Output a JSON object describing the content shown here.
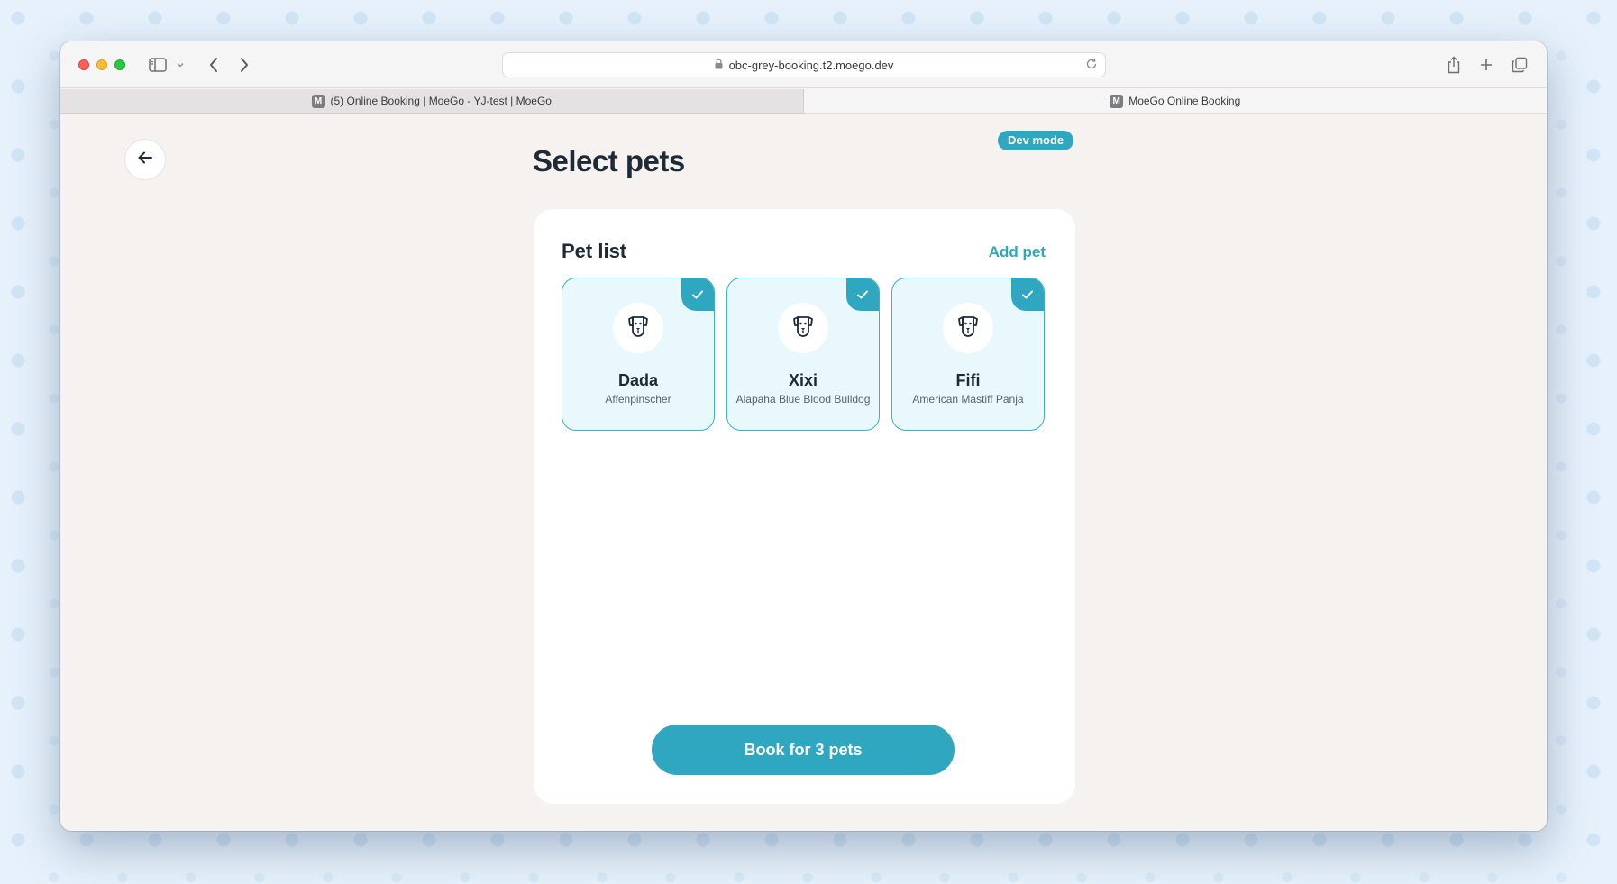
{
  "browser": {
    "url": "obc-grey-booking.t2.moego.dev",
    "tabs": [
      {
        "label": "(5) Online Booking | MoeGo - YJ-test | MoeGo",
        "favicon": "M"
      },
      {
        "label": "MoeGo Online Booking",
        "favicon": "M"
      }
    ]
  },
  "page": {
    "title": "Select pets",
    "dev_badge": "Dev mode",
    "card_title": "Pet list",
    "add_pet": "Add pet",
    "book_button": "Book for 3 pets"
  },
  "pets": [
    {
      "name": "Dada",
      "breed": "Affenpinscher",
      "selected": true,
      "icon": "dog-icon"
    },
    {
      "name": "Xixi",
      "breed": "Alapaha Blue Blood Bulldog",
      "selected": true,
      "icon": "dog-icon"
    },
    {
      "name": "Fifi",
      "breed": "American Mastiff Panja",
      "selected": true,
      "icon": "dog-icon"
    }
  ],
  "colors": {
    "accent": "#2fa7c0",
    "selected_card_bg": "#e8f8fc",
    "page_bg": "#f5f2ef",
    "title_text": "#1e2a35"
  }
}
